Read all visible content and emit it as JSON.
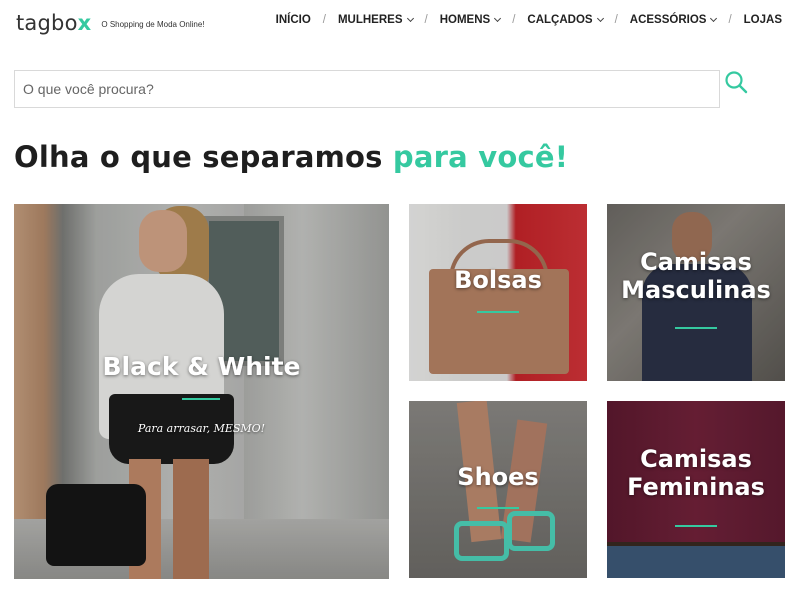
{
  "brand": {
    "logo_text": "tagbo",
    "logo_accent": "x",
    "tagline": "O Shopping de Moda Online!",
    "accent_color": "#35c9a0"
  },
  "nav": {
    "items": [
      {
        "label": "INÍCIO",
        "dropdown": false
      },
      {
        "label": "MULHERES",
        "dropdown": true
      },
      {
        "label": "HOMENS",
        "dropdown": true
      },
      {
        "label": "CALÇADOS",
        "dropdown": true
      },
      {
        "label": "ACESSÓRIOS",
        "dropdown": true
      },
      {
        "label": "LOJAS",
        "dropdown": false
      }
    ],
    "separator": "/"
  },
  "search": {
    "placeholder": "O que você procura?",
    "value": "",
    "icon": "search-icon"
  },
  "heading": {
    "main": "Olha o que separamos ",
    "accent": "para você!"
  },
  "tiles": {
    "black_white": {
      "title": "Black & White",
      "subtitle": "Para arrasar, MESMO!"
    },
    "bolsas": {
      "title": "Bolsas"
    },
    "camisas_masculinas": {
      "title_line1": "Camisas",
      "title_line2": "Masculinas"
    },
    "shoes": {
      "title": "Shoes"
    },
    "camisas_femininas": {
      "title_line1": "Camisas",
      "title_line2": "Femininas"
    }
  }
}
